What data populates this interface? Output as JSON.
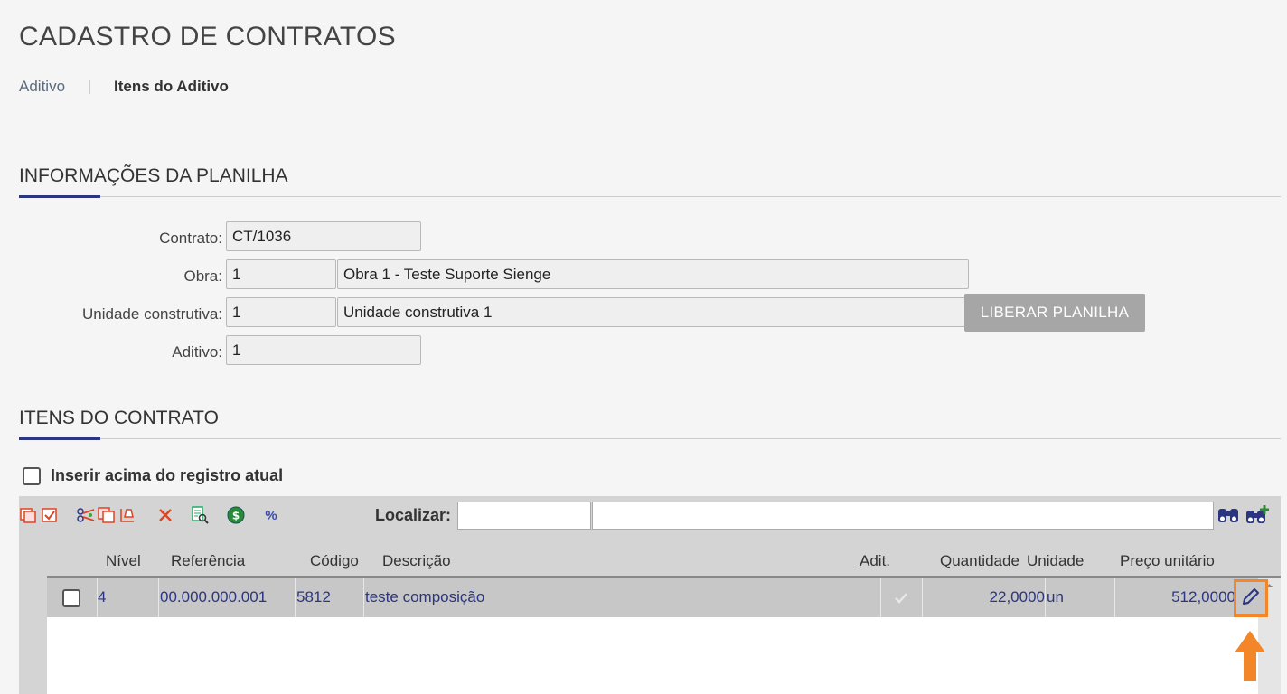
{
  "page": {
    "title": "CADASTRO DE CONTRATOS"
  },
  "tabs": [
    {
      "label": "Aditivo",
      "active": false
    },
    {
      "label": "Itens do Aditivo",
      "active": true
    }
  ],
  "planilha": {
    "section_title": "INFORMAÇÕES DA PLANILHA",
    "contrato_label": "Contrato:",
    "contrato_value": "CT/1036",
    "obra_label": "Obra:",
    "obra_code": "1",
    "obra_name": "Obra 1 - Teste Suporte Sienge",
    "unidade_label": "Unidade construtiva:",
    "unidade_code": "1",
    "unidade_name": "Unidade construtiva 1",
    "aditivo_label": "Aditivo:",
    "aditivo_value": "1",
    "liberar_button": "LIBERAR PLANILHA"
  },
  "itens": {
    "section_title": "ITENS DO CONTRATO",
    "inserir_acima_label": "Inserir acima do registro atual",
    "inserir_acima_checked": false,
    "toolbar": {
      "localizar_label": "Localizar:",
      "localizar_value": "",
      "localizar_text": "",
      "percent_symbol": "%",
      "icons": [
        "new-rows-icon",
        "select-all-icon",
        "cut-icon",
        "copy-icon",
        "paste-icon",
        "delete-icon",
        "find-document-icon",
        "money-icon",
        "percent-icon",
        "binoculars-icon",
        "binoculars-add-icon"
      ]
    },
    "columns": [
      "Nível",
      "Referência",
      "Código",
      "Descrição",
      "Adit.",
      "Quantidade",
      "Unidade",
      "Preço unitário"
    ],
    "rows": [
      {
        "selected": false,
        "nivel": "4",
        "referencia": "00.000.000.001",
        "codigo": "5812",
        "descricao": "teste composição",
        "aditivo": true,
        "quantidade": "22,0000",
        "unidade": "un",
        "preco_unitario": "512,0000"
      }
    ]
  },
  "colors": {
    "accent": "#2b3580",
    "highlight": "#f4862a",
    "button_disabled": "#a6a6a6"
  }
}
